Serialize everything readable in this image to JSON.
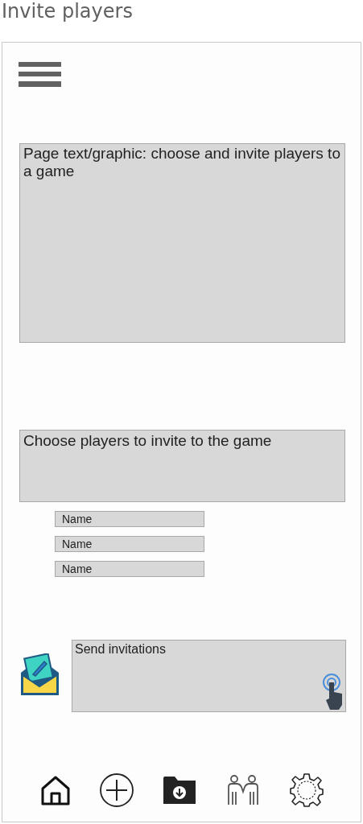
{
  "title": "Invite players",
  "intro_panel": {
    "text": "Page text/graphic: choose and invite players to a game"
  },
  "choose_panel": {
    "text": "Choose players to invite to the game"
  },
  "player_fields": [
    {
      "placeholder": "Name"
    },
    {
      "placeholder": "Name"
    },
    {
      "placeholder": "Name"
    }
  ],
  "send_button": {
    "label": "Send invitations"
  },
  "nav_items": [
    {
      "kind": "home"
    },
    {
      "kind": "add"
    },
    {
      "kind": "folder"
    },
    {
      "kind": "people"
    },
    {
      "kind": "settings"
    }
  ]
}
